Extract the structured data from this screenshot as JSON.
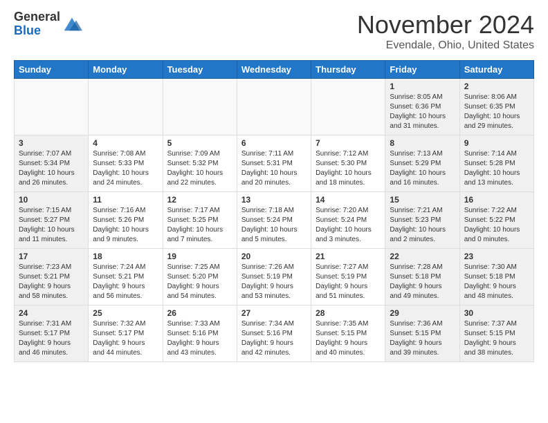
{
  "logo": {
    "general": "General",
    "blue": "Blue"
  },
  "header": {
    "title": "November 2024",
    "subtitle": "Evendale, Ohio, United States"
  },
  "days_of_week": [
    "Sunday",
    "Monday",
    "Tuesday",
    "Wednesday",
    "Thursday",
    "Friday",
    "Saturday"
  ],
  "weeks": [
    [
      {
        "day": "",
        "empty": true,
        "weekend": false
      },
      {
        "day": "",
        "empty": true,
        "weekend": false
      },
      {
        "day": "",
        "empty": true,
        "weekend": false
      },
      {
        "day": "",
        "empty": true,
        "weekend": false
      },
      {
        "day": "",
        "empty": true,
        "weekend": false
      },
      {
        "day": "1",
        "sunrise": "Sunrise: 8:05 AM",
        "sunset": "Sunset: 6:36 PM",
        "daylight": "Daylight: 10 hours and 31 minutes.",
        "weekend": true
      },
      {
        "day": "2",
        "sunrise": "Sunrise: 8:06 AM",
        "sunset": "Sunset: 6:35 PM",
        "daylight": "Daylight: 10 hours and 29 minutes.",
        "weekend": true
      }
    ],
    [
      {
        "day": "3",
        "sunrise": "Sunrise: 7:07 AM",
        "sunset": "Sunset: 5:34 PM",
        "daylight": "Daylight: 10 hours and 26 minutes.",
        "weekend": true
      },
      {
        "day": "4",
        "sunrise": "Sunrise: 7:08 AM",
        "sunset": "Sunset: 5:33 PM",
        "daylight": "Daylight: 10 hours and 24 minutes.",
        "weekend": false
      },
      {
        "day": "5",
        "sunrise": "Sunrise: 7:09 AM",
        "sunset": "Sunset: 5:32 PM",
        "daylight": "Daylight: 10 hours and 22 minutes.",
        "weekend": false
      },
      {
        "day": "6",
        "sunrise": "Sunrise: 7:11 AM",
        "sunset": "Sunset: 5:31 PM",
        "daylight": "Daylight: 10 hours and 20 minutes.",
        "weekend": false
      },
      {
        "day": "7",
        "sunrise": "Sunrise: 7:12 AM",
        "sunset": "Sunset: 5:30 PM",
        "daylight": "Daylight: 10 hours and 18 minutes.",
        "weekend": false
      },
      {
        "day": "8",
        "sunrise": "Sunrise: 7:13 AM",
        "sunset": "Sunset: 5:29 PM",
        "daylight": "Daylight: 10 hours and 16 minutes.",
        "weekend": true
      },
      {
        "day": "9",
        "sunrise": "Sunrise: 7:14 AM",
        "sunset": "Sunset: 5:28 PM",
        "daylight": "Daylight: 10 hours and 13 minutes.",
        "weekend": true
      }
    ],
    [
      {
        "day": "10",
        "sunrise": "Sunrise: 7:15 AM",
        "sunset": "Sunset: 5:27 PM",
        "daylight": "Daylight: 10 hours and 11 minutes.",
        "weekend": true
      },
      {
        "day": "11",
        "sunrise": "Sunrise: 7:16 AM",
        "sunset": "Sunset: 5:26 PM",
        "daylight": "Daylight: 10 hours and 9 minutes.",
        "weekend": false
      },
      {
        "day": "12",
        "sunrise": "Sunrise: 7:17 AM",
        "sunset": "Sunset: 5:25 PM",
        "daylight": "Daylight: 10 hours and 7 minutes.",
        "weekend": false
      },
      {
        "day": "13",
        "sunrise": "Sunrise: 7:18 AM",
        "sunset": "Sunset: 5:24 PM",
        "daylight": "Daylight: 10 hours and 5 minutes.",
        "weekend": false
      },
      {
        "day": "14",
        "sunrise": "Sunrise: 7:20 AM",
        "sunset": "Sunset: 5:24 PM",
        "daylight": "Daylight: 10 hours and 3 minutes.",
        "weekend": false
      },
      {
        "day": "15",
        "sunrise": "Sunrise: 7:21 AM",
        "sunset": "Sunset: 5:23 PM",
        "daylight": "Daylight: 10 hours and 2 minutes.",
        "weekend": true
      },
      {
        "day": "16",
        "sunrise": "Sunrise: 7:22 AM",
        "sunset": "Sunset: 5:22 PM",
        "daylight": "Daylight: 10 hours and 0 minutes.",
        "weekend": true
      }
    ],
    [
      {
        "day": "17",
        "sunrise": "Sunrise: 7:23 AM",
        "sunset": "Sunset: 5:21 PM",
        "daylight": "Daylight: 9 hours and 58 minutes.",
        "weekend": true
      },
      {
        "day": "18",
        "sunrise": "Sunrise: 7:24 AM",
        "sunset": "Sunset: 5:21 PM",
        "daylight": "Daylight: 9 hours and 56 minutes.",
        "weekend": false
      },
      {
        "day": "19",
        "sunrise": "Sunrise: 7:25 AM",
        "sunset": "Sunset: 5:20 PM",
        "daylight": "Daylight: 9 hours and 54 minutes.",
        "weekend": false
      },
      {
        "day": "20",
        "sunrise": "Sunrise: 7:26 AM",
        "sunset": "Sunset: 5:19 PM",
        "daylight": "Daylight: 9 hours and 53 minutes.",
        "weekend": false
      },
      {
        "day": "21",
        "sunrise": "Sunrise: 7:27 AM",
        "sunset": "Sunset: 5:19 PM",
        "daylight": "Daylight: 9 hours and 51 minutes.",
        "weekend": false
      },
      {
        "day": "22",
        "sunrise": "Sunrise: 7:28 AM",
        "sunset": "Sunset: 5:18 PM",
        "daylight": "Daylight: 9 hours and 49 minutes.",
        "weekend": true
      },
      {
        "day": "23",
        "sunrise": "Sunrise: 7:30 AM",
        "sunset": "Sunset: 5:18 PM",
        "daylight": "Daylight: 9 hours and 48 minutes.",
        "weekend": true
      }
    ],
    [
      {
        "day": "24",
        "sunrise": "Sunrise: 7:31 AM",
        "sunset": "Sunset: 5:17 PM",
        "daylight": "Daylight: 9 hours and 46 minutes.",
        "weekend": true
      },
      {
        "day": "25",
        "sunrise": "Sunrise: 7:32 AM",
        "sunset": "Sunset: 5:17 PM",
        "daylight": "Daylight: 9 hours and 44 minutes.",
        "weekend": false
      },
      {
        "day": "26",
        "sunrise": "Sunrise: 7:33 AM",
        "sunset": "Sunset: 5:16 PM",
        "daylight": "Daylight: 9 hours and 43 minutes.",
        "weekend": false
      },
      {
        "day": "27",
        "sunrise": "Sunrise: 7:34 AM",
        "sunset": "Sunset: 5:16 PM",
        "daylight": "Daylight: 9 hours and 42 minutes.",
        "weekend": false
      },
      {
        "day": "28",
        "sunrise": "Sunrise: 7:35 AM",
        "sunset": "Sunset: 5:15 PM",
        "daylight": "Daylight: 9 hours and 40 minutes.",
        "weekend": false
      },
      {
        "day": "29",
        "sunrise": "Sunrise: 7:36 AM",
        "sunset": "Sunset: 5:15 PM",
        "daylight": "Daylight: 9 hours and 39 minutes.",
        "weekend": true
      },
      {
        "day": "30",
        "sunrise": "Sunrise: 7:37 AM",
        "sunset": "Sunset: 5:15 PM",
        "daylight": "Daylight: 9 hours and 38 minutes.",
        "weekend": true
      }
    ]
  ]
}
